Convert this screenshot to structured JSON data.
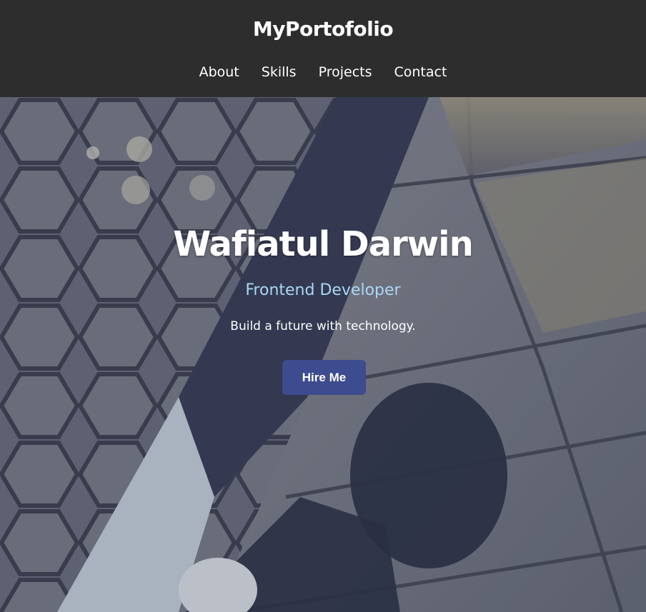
{
  "header": {
    "brand": "MyPortofolio",
    "nav": [
      {
        "label": "About"
      },
      {
        "label": "Skills"
      },
      {
        "label": "Projects"
      },
      {
        "label": "Contact"
      }
    ]
  },
  "hero": {
    "name": "Wafiatul Darwin",
    "role": "Frontend Developer",
    "tagline": "Build a future with technology.",
    "cta_label": "Hire Me",
    "colors": {
      "header_bg": "#2d2d2d",
      "role_text": "#a9d7f5",
      "cta_bg": "#3d4b8f"
    }
  }
}
